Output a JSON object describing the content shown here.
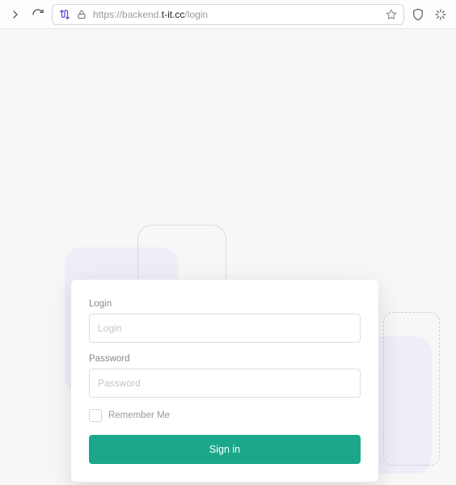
{
  "browser": {
    "url_prefix": "https://",
    "url_sub": "backend.",
    "url_domain": "t-it.cc",
    "url_path": "/login"
  },
  "login": {
    "login_label": "Login",
    "login_placeholder": "Login",
    "password_label": "Password",
    "password_placeholder": "Password",
    "remember_label": "Remember Me",
    "signin_label": "Sign in"
  }
}
